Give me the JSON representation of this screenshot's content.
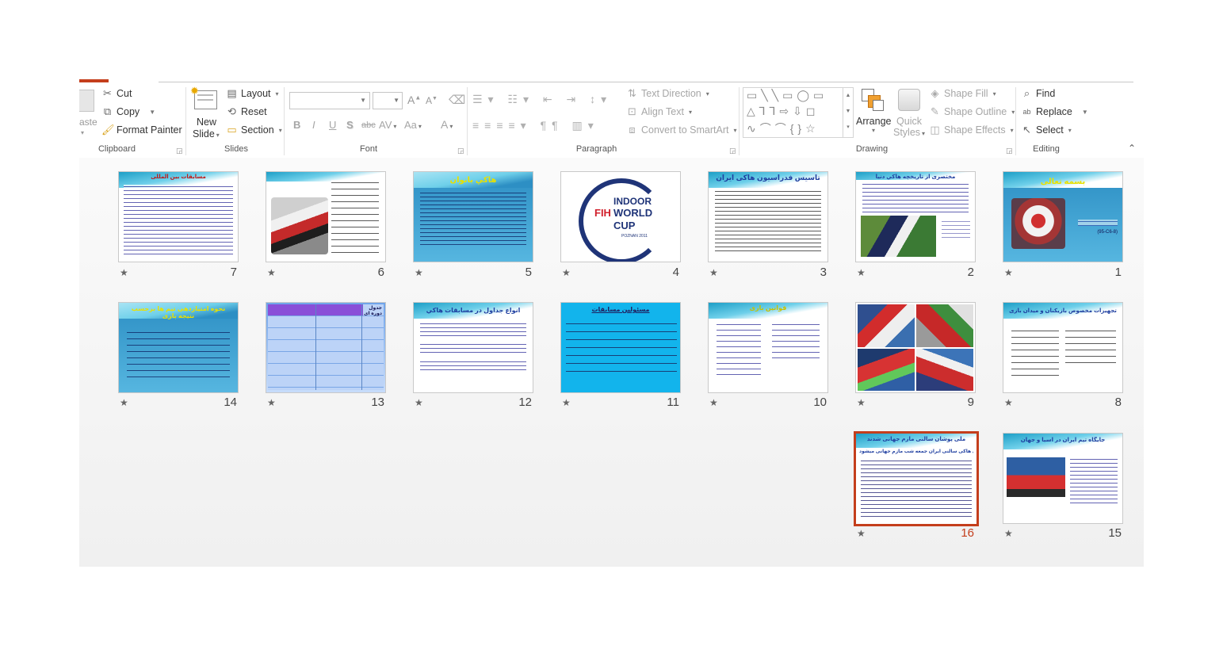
{
  "ribbon": {
    "clipboard": {
      "paste_label": "aste",
      "cut_label": "Cut",
      "copy_label": "Copy",
      "format_painter_label": "Format Painter",
      "group_label": "Clipboard"
    },
    "slides": {
      "new_slide_label": "New",
      "new_slide_label2": "Slide",
      "layout_label": "Layout",
      "reset_label": "Reset",
      "section_label": "Section",
      "group_label": "Slides"
    },
    "font": {
      "group_label": "Font",
      "bold": "B",
      "italic": "I",
      "underline": "U",
      "shadow": "S",
      "strike": "abc",
      "spacing": "AV",
      "case": "Aa",
      "color": "A",
      "grow": "A",
      "shrink": "A"
    },
    "paragraph": {
      "group_label": "Paragraph",
      "text_direction_label": "Text Direction",
      "align_text_label": "Align Text",
      "smartart_label": "Convert to SmartArt"
    },
    "drawing": {
      "group_label": "Drawing",
      "arrange_label": "Arrange",
      "quick_styles_label": "Quick",
      "quick_styles_label2": "Styles",
      "shape_fill_label": "Shape Fill",
      "shape_outline_label": "Shape Outline",
      "shape_effects_label": "Shape Effects"
    },
    "editing": {
      "group_label": "Editing",
      "find_label": "Find",
      "replace_label": "Replace",
      "select_label": "Select"
    }
  },
  "slides": [
    {
      "number": "1",
      "title": "بسمه تعالی",
      "subtitle": "(95-C6-8)"
    },
    {
      "number": "2",
      "title": "مختصری از تاریخچه هاكي دنیا"
    },
    {
      "number": "3",
      "title": "تاسیس فدراسیون هاکی ایران"
    },
    {
      "number": "4",
      "logo_line1": "INDOOR",
      "logo_line2": "WORLD",
      "logo_line3": "CUP",
      "logo_brand": "FIH",
      "logo_place": "POZNAN 2011"
    },
    {
      "number": "5",
      "title": "هاكي بانوان"
    },
    {
      "number": "6",
      "title": ""
    },
    {
      "number": "7",
      "title": "مسابقات بین المللی"
    },
    {
      "number": "8",
      "title": "تجهیزات مخصوص بازیکنان و میدان بازی"
    },
    {
      "number": "9",
      "title": ""
    },
    {
      "number": "10",
      "title": "قوانین بازی"
    },
    {
      "number": "11",
      "title": "مسئولین مسابقات"
    },
    {
      "number": "12",
      "title": "انواع جداول در مسابقات هاكي"
    },
    {
      "number": "13",
      "title": "جدول دوره ای"
    },
    {
      "number": "14",
      "title": "نحوه امتیازدهی تیم ها برحسب نتیجه بازی"
    },
    {
      "number": "15",
      "title": "جایگاه تیم ایران در آسیا و جهان"
    },
    {
      "number": "16",
      "title": "ملی پوشان سالنی مازم جهانی شدند",
      "subtitle": "تیم ملی هاکی سالنی ایران جمعه شب مازم جهانی میشود"
    }
  ],
  "colors": {
    "accent": "#c43e1c",
    "slide_blue": "#1d9fc7",
    "slide11_bg": "#12b4ec"
  },
  "icons": [
    "scissors-icon",
    "copy-icon",
    "format-painter-icon",
    "new-slide-icon",
    "layout-icon",
    "reset-icon",
    "section-icon",
    "text-direction-icon",
    "align-text-icon",
    "smartart-icon",
    "arrange-icon",
    "quick-styles-icon",
    "shape-fill-icon",
    "shape-outline-icon",
    "shape-effects-icon",
    "find-icon",
    "replace-icon",
    "select-icon",
    "star-icon"
  ]
}
